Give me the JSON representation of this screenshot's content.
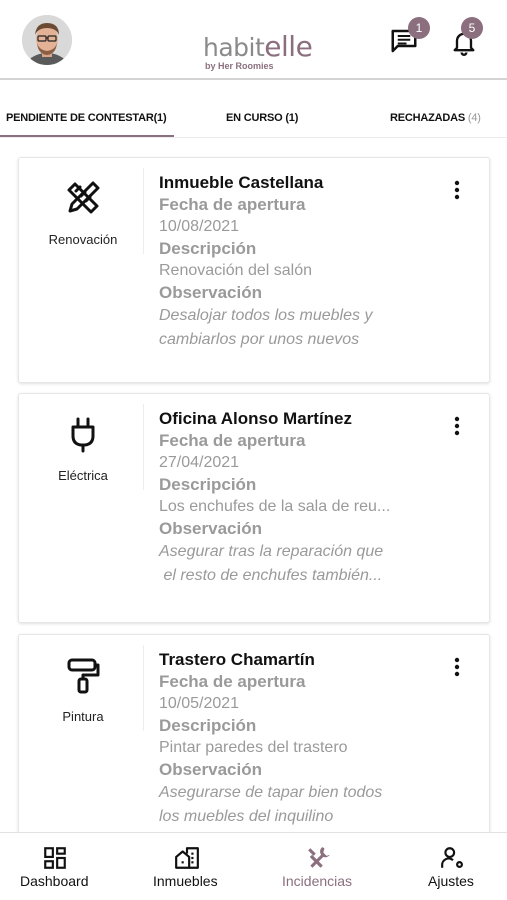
{
  "header": {
    "avatar_icon": "user-avatar",
    "logo_text_main": "habit",
    "logo_text_accent": "elle",
    "logo_tagline": "by Her Roomies",
    "messages_badge": "1",
    "notifications_badge": "5",
    "accent_color": "#8b6f7e"
  },
  "tabs": [
    {
      "label": "PENDIENTE DE CONTESTAR(1)",
      "active": true
    },
    {
      "label": "EN CURSO (1)",
      "active": false
    },
    {
      "label": "RECHAZADAS",
      "count": "(4)",
      "active": false
    }
  ],
  "incidents": [
    {
      "category": "Renovación",
      "category_icon": "renovation-tools-icon",
      "title": "Inmueble Castellana",
      "date_label": "Fecha de apertura",
      "date": "10/08/2021",
      "desc_label": "Descripción",
      "description": "Renovación del salón",
      "obs_label": "Observación",
      "observation_line1": "Desalojar todos los muebles y",
      "observation_line2": "cambiarlos por unos nuevos"
    },
    {
      "category": "Eléctrica",
      "category_icon": "plug-icon",
      "title": "Oficina Alonso Martínez",
      "date_label": "Fecha de apertura",
      "date": "27/04/2021",
      "desc_label": "Descripción",
      "description": "Los enchufes de la sala de reu...",
      "obs_label": "Observación",
      "observation_line1": "Asegurar tras la reparación que",
      "observation_line2": " el resto de enchufes también..."
    },
    {
      "category": "Pintura",
      "category_icon": "paint-roller-icon",
      "title": "Trastero Chamartín",
      "date_label": "Fecha de apertura",
      "date": "10/05/2021",
      "desc_label": "Descripción",
      "description": "Pintar paredes del trastero",
      "obs_label": "Observación",
      "observation_line1": "Asegurarse de tapar bien todos",
      "observation_line2": "los muebles del inquilino"
    }
  ],
  "bottom_nav": [
    {
      "label": "Dashboard",
      "icon": "dashboard-icon",
      "active": false
    },
    {
      "label": "Inmuebles",
      "icon": "building-icon",
      "active": false
    },
    {
      "label": "Incidencias",
      "icon": "tools-icon",
      "active": true
    },
    {
      "label": "Ajustes",
      "icon": "user-settings-icon",
      "active": false
    }
  ]
}
